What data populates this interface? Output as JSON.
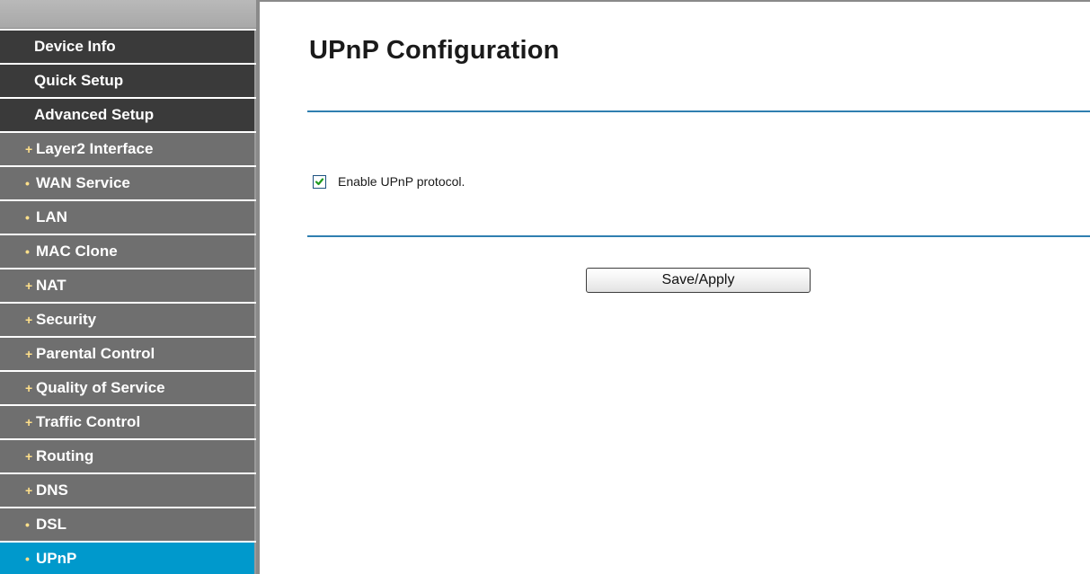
{
  "sidebar": {
    "items": [
      {
        "label": "Device Info",
        "level": "top",
        "bullet": ""
      },
      {
        "label": "Quick Setup",
        "level": "top",
        "bullet": ""
      },
      {
        "label": "Advanced Setup",
        "level": "top",
        "bullet": ""
      },
      {
        "label": "Layer2 Interface",
        "level": "sub",
        "bullet": "+"
      },
      {
        "label": "WAN Service",
        "level": "sub",
        "bullet": "•"
      },
      {
        "label": "LAN",
        "level": "sub",
        "bullet": "•"
      },
      {
        "label": "MAC Clone",
        "level": "sub",
        "bullet": "•"
      },
      {
        "label": "NAT",
        "level": "sub",
        "bullet": "+"
      },
      {
        "label": "Security",
        "level": "sub",
        "bullet": "+"
      },
      {
        "label": "Parental Control",
        "level": "sub",
        "bullet": "+"
      },
      {
        "label": "Quality of Service",
        "level": "sub",
        "bullet": "+"
      },
      {
        "label": "Traffic Control",
        "level": "sub",
        "bullet": "+"
      },
      {
        "label": "Routing",
        "level": "sub",
        "bullet": "+"
      },
      {
        "label": "DNS",
        "level": "sub",
        "bullet": "+"
      },
      {
        "label": "DSL",
        "level": "sub",
        "bullet": "•"
      },
      {
        "label": "UPnP",
        "level": "sub",
        "bullet": "•",
        "active": true
      }
    ]
  },
  "main": {
    "title": "UPnP Configuration",
    "enable_upnp": {
      "label": "Enable UPnP protocol.",
      "checked": true
    },
    "save_button_label": "Save/Apply"
  },
  "colors": {
    "sidebar_top": "#3a3a3a",
    "sidebar_sub": "#6f6f6f",
    "sidebar_active": "#0099cc",
    "divider_line": "#2f7fb0"
  },
  "icons": {
    "checkbox_mark": "check-icon",
    "sub_bullet_plus": "plus-bullet-icon",
    "sub_bullet_dot": "dot-bullet-icon"
  }
}
